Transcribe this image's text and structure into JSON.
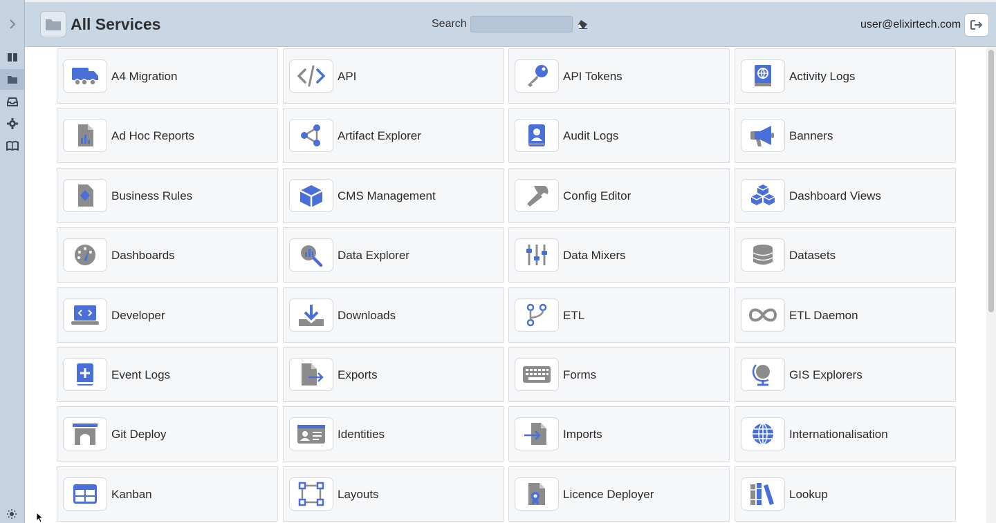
{
  "header": {
    "title": "All Services",
    "search_label": "Search",
    "search_value": "",
    "user_email": "user@elixirtech.com"
  },
  "rail": {
    "items": [
      {
        "icon": "book-open-icon",
        "active": false
      },
      {
        "icon": "folder-icon",
        "active": true
      },
      {
        "icon": "inbox-icon",
        "active": false
      },
      {
        "icon": "gear-icon",
        "active": false
      },
      {
        "icon": "book-icon",
        "active": false
      }
    ]
  },
  "accent_color": "#4a6fd8",
  "grey_icon_color": "#8c8c8c",
  "services": [
    {
      "label": "A4 Migration",
      "icon": "truck-icon"
    },
    {
      "label": "API",
      "icon": "code-icon"
    },
    {
      "label": "API Tokens",
      "icon": "key-icon"
    },
    {
      "label": "Activity Logs",
      "icon": "globe-book-icon"
    },
    {
      "label": "Ad Hoc Reports",
      "icon": "report-chart-icon"
    },
    {
      "label": "Artifact Explorer",
      "icon": "share-nodes-icon"
    },
    {
      "label": "Audit Logs",
      "icon": "user-book-icon"
    },
    {
      "label": "Banners",
      "icon": "bullhorn-icon"
    },
    {
      "label": "Business Rules",
      "icon": "rule-file-icon"
    },
    {
      "label": "CMS Management",
      "icon": "cube-icon"
    },
    {
      "label": "Config Editor",
      "icon": "hammer-icon"
    },
    {
      "label": "Dashboard Views",
      "icon": "cubes-icon"
    },
    {
      "label": "Dashboards",
      "icon": "gauge-icon"
    },
    {
      "label": "Data Explorer",
      "icon": "search-chart-icon"
    },
    {
      "label": "Data Mixers",
      "icon": "sliders-icon"
    },
    {
      "label": "Datasets",
      "icon": "database-icon"
    },
    {
      "label": "Developer",
      "icon": "laptop-code-icon"
    },
    {
      "label": "Downloads",
      "icon": "download-icon"
    },
    {
      "label": "ETL",
      "icon": "branch-icon"
    },
    {
      "label": "ETL Daemon",
      "icon": "infinity-icon"
    },
    {
      "label": "Event Logs",
      "icon": "plus-book-icon"
    },
    {
      "label": "Exports",
      "icon": "file-export-icon"
    },
    {
      "label": "Forms",
      "icon": "keyboard-icon"
    },
    {
      "label": "GIS Explorers",
      "icon": "globe-stand-icon"
    },
    {
      "label": "Git Deploy",
      "icon": "archway-icon"
    },
    {
      "label": "Identities",
      "icon": "id-card-icon"
    },
    {
      "label": "Imports",
      "icon": "file-import-icon"
    },
    {
      "label": "Internationalisation",
      "icon": "globe-icon"
    },
    {
      "label": "Kanban",
      "icon": "table-icon"
    },
    {
      "label": "Layouts",
      "icon": "vector-square-icon"
    },
    {
      "label": "Licence Deployer",
      "icon": "file-certificate-icon"
    },
    {
      "label": "Lookup",
      "icon": "books-icon"
    }
  ]
}
